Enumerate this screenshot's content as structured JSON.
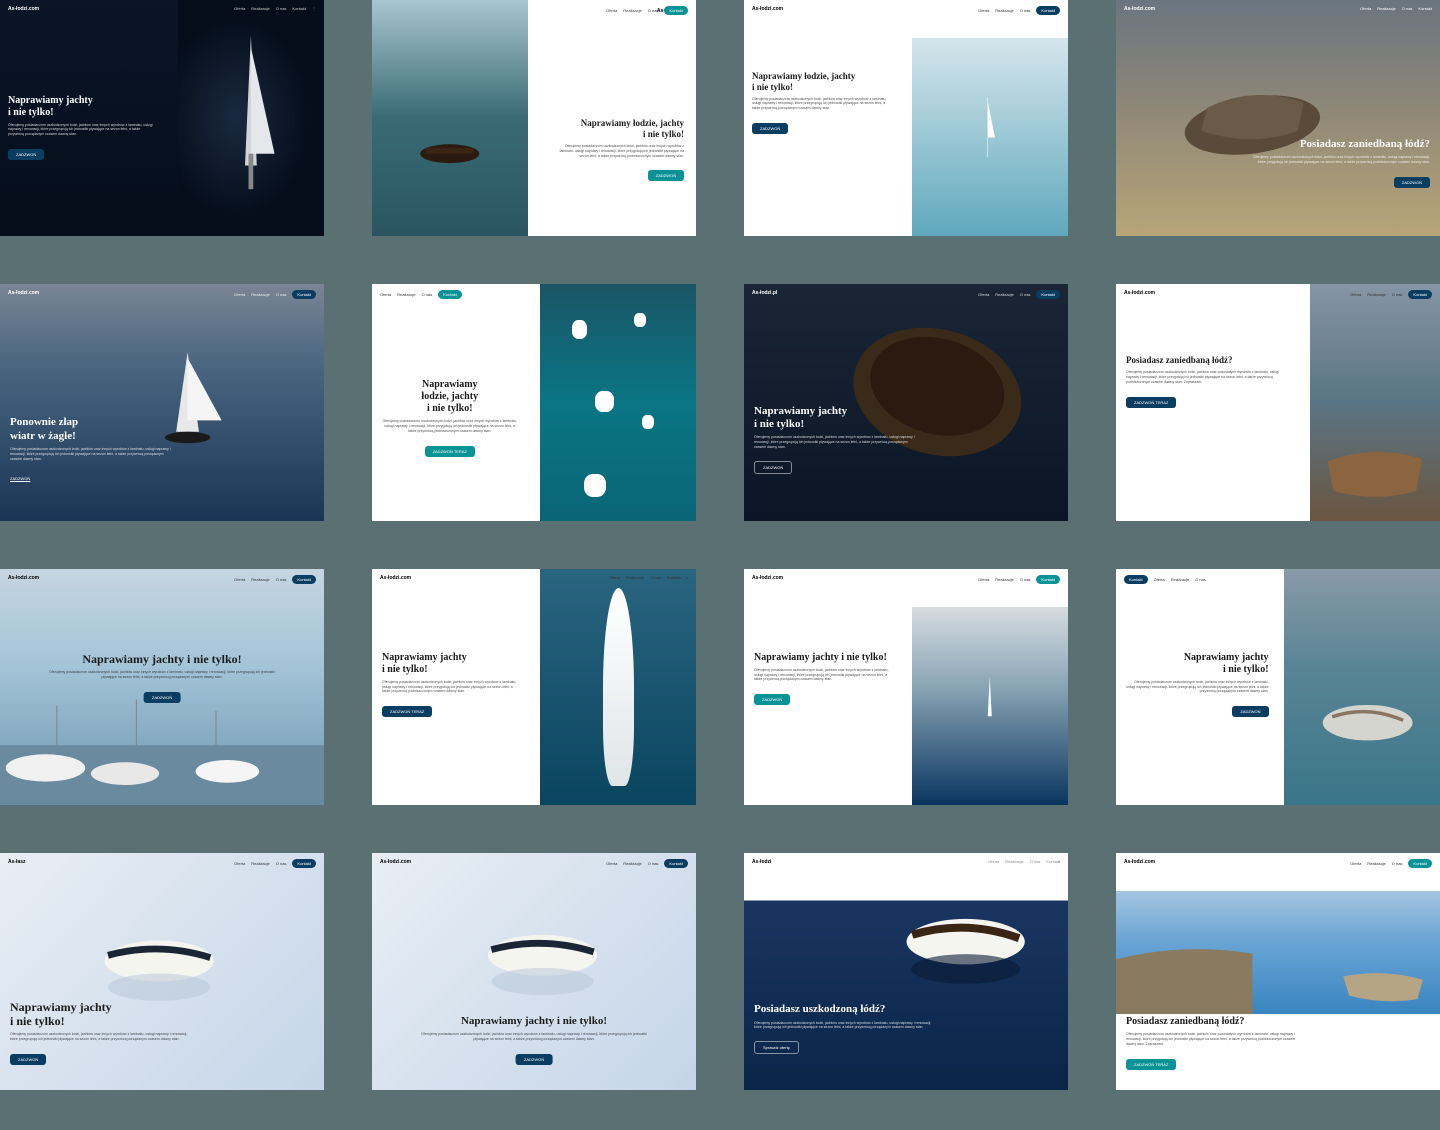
{
  "nav": {
    "items": [
      "Oferta",
      "Realizacje",
      "O nas"
    ],
    "cta": "Kontakt"
  },
  "logos": {
    "default": "As-łodzi.com",
    "alt1": "As-łodzi.pl",
    "alt2": "As-łasz",
    "alt3": "As-łodzi"
  },
  "headlines": {
    "yachts": "Naprawiamy jachty\ni nie tylko!",
    "boats_yachts": "Naprawiamy łodzie, jachty\ni nie tylko!",
    "neglected": "Posiadasz zaniedbaną łódź?",
    "damaged": "Posiadasz uszkodzoną łódź?",
    "sails": "Ponownie złap\nwiatr w żagle!",
    "yachts_single": "Naprawiamy jachty i nie tylko!",
    "boats_short": "Naprawiamy\nłodzie, jachty\ni nie tylko!"
  },
  "body": {
    "main": "Oferujemy posiadaczom uszkodzonych łodzi, jachtów oraz innych wyrobów z laminatu, usługi naprawy i renowacji, które przegrupują ich jednostki pływające na sezon letni, a także przywrócą porządanym czasem dawny stan.",
    "short": "Oferujemy posiadaczom uszkodzonych łodzi, jachtów oraz innych wyrobów z laminatu, usługi naprawy i renowacji, które przygotują ich jednostki pływające na sezon letni, a także przywrócą podniszczonym czasem dawny stan.",
    "extended": "Oferujemy posiadaczom uszkodzonych łodzi, jachtów oraz pozostałych wyrobów z laminatu, usługi naprawy i renowacji, które przygotują ich jednostki pływające na sezon letni, a także przywrócą podniszczonym czasem dawny stan. Zapraszam."
  },
  "ctas": {
    "call": "ZADZWOŃ",
    "call_teal": "ZADZWOŃ TERAZ",
    "offer": "Sprawdź ofertę"
  }
}
